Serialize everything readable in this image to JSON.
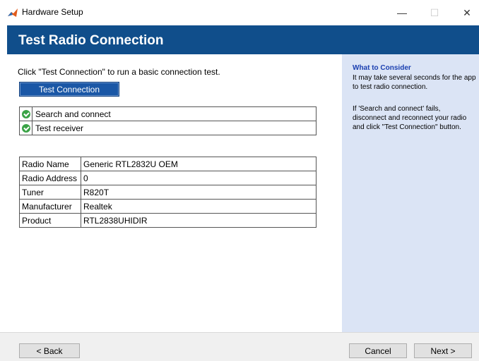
{
  "window": {
    "title": "Hardware Setup",
    "controls": {
      "minimize": "—",
      "maximize": "☐",
      "close": "✕"
    }
  },
  "banner": {
    "title": "Test Radio Connection",
    "color": "#104e8b"
  },
  "main": {
    "instruction": "Click \"Test Connection\" to run a basic connection test.",
    "test_button": "Test Connection",
    "status_rows": [
      {
        "label": "Search and connect",
        "icon": "check-circle-icon"
      },
      {
        "label": "Test receiver",
        "icon": "check-circle-icon"
      }
    ],
    "info_rows": [
      {
        "key": "Radio Name",
        "value": "Generic RTL2832U OEM"
      },
      {
        "key": "Radio Address",
        "value": "0"
      },
      {
        "key": "Tuner",
        "value": "R820T"
      },
      {
        "key": "Manufacturer",
        "value": "Realtek"
      },
      {
        "key": "Product",
        "value": "RTL2838UHIDIR"
      }
    ]
  },
  "side": {
    "heading": "What to Consider",
    "p1": "It may take several seconds for the app to test radio connection.",
    "p2": "If 'Search and connect' fails, disconnect and reconnect your radio and click \"Test Connection\" button."
  },
  "footer": {
    "back": "< Back",
    "cancel": "Cancel",
    "next": "Next >"
  }
}
